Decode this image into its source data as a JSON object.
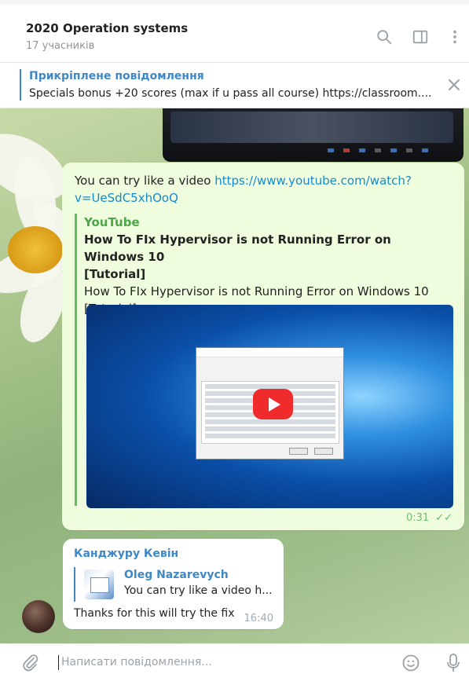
{
  "header": {
    "title": "2020 Operation systems",
    "subtitle": "17 учасників",
    "icons": [
      "search-icon",
      "sidebar-toggle-icon",
      "more-vertical-icon"
    ]
  },
  "pinned": {
    "label": "Прикріплене повідомлення",
    "text": "Specials bonus +20 scores (max if u pass all course) https://classroom...."
  },
  "messages": {
    "outgoing": {
      "text_prefix": "You can try like a video ",
      "link": "https://www.youtube.com/watch?v=UeSdC5xhOoQ",
      "link_line1": "https://www.youtube.com/watch?",
      "link_line2": "v=UeSdC5xhOoQ",
      "preview": {
        "site": "YouTube",
        "title_line1": "How To FIx Hypervisor is not Running Error on Windows 10",
        "title_line2": "[Tutorial]",
        "desc_line1": "How To FIx Hypervisor is not Running Error on Windows 10",
        "desc_line2": "[Tutorial]..."
      },
      "time": "0:31",
      "status": "read"
    },
    "incoming": {
      "sender": "Канджуру Кевін",
      "reply_to": {
        "name": "Oleg Nazarevych",
        "text": "You can try like a video h..."
      },
      "text": "Thanks for this will try the fix",
      "time": "16:40"
    }
  },
  "composer": {
    "placeholder": "Написати повідомлення..."
  },
  "colors": {
    "accent": "#3e88c7",
    "link": "#168acd",
    "outgoing_bubble": "#effdde",
    "preview_bar": "#5fbf5b"
  }
}
